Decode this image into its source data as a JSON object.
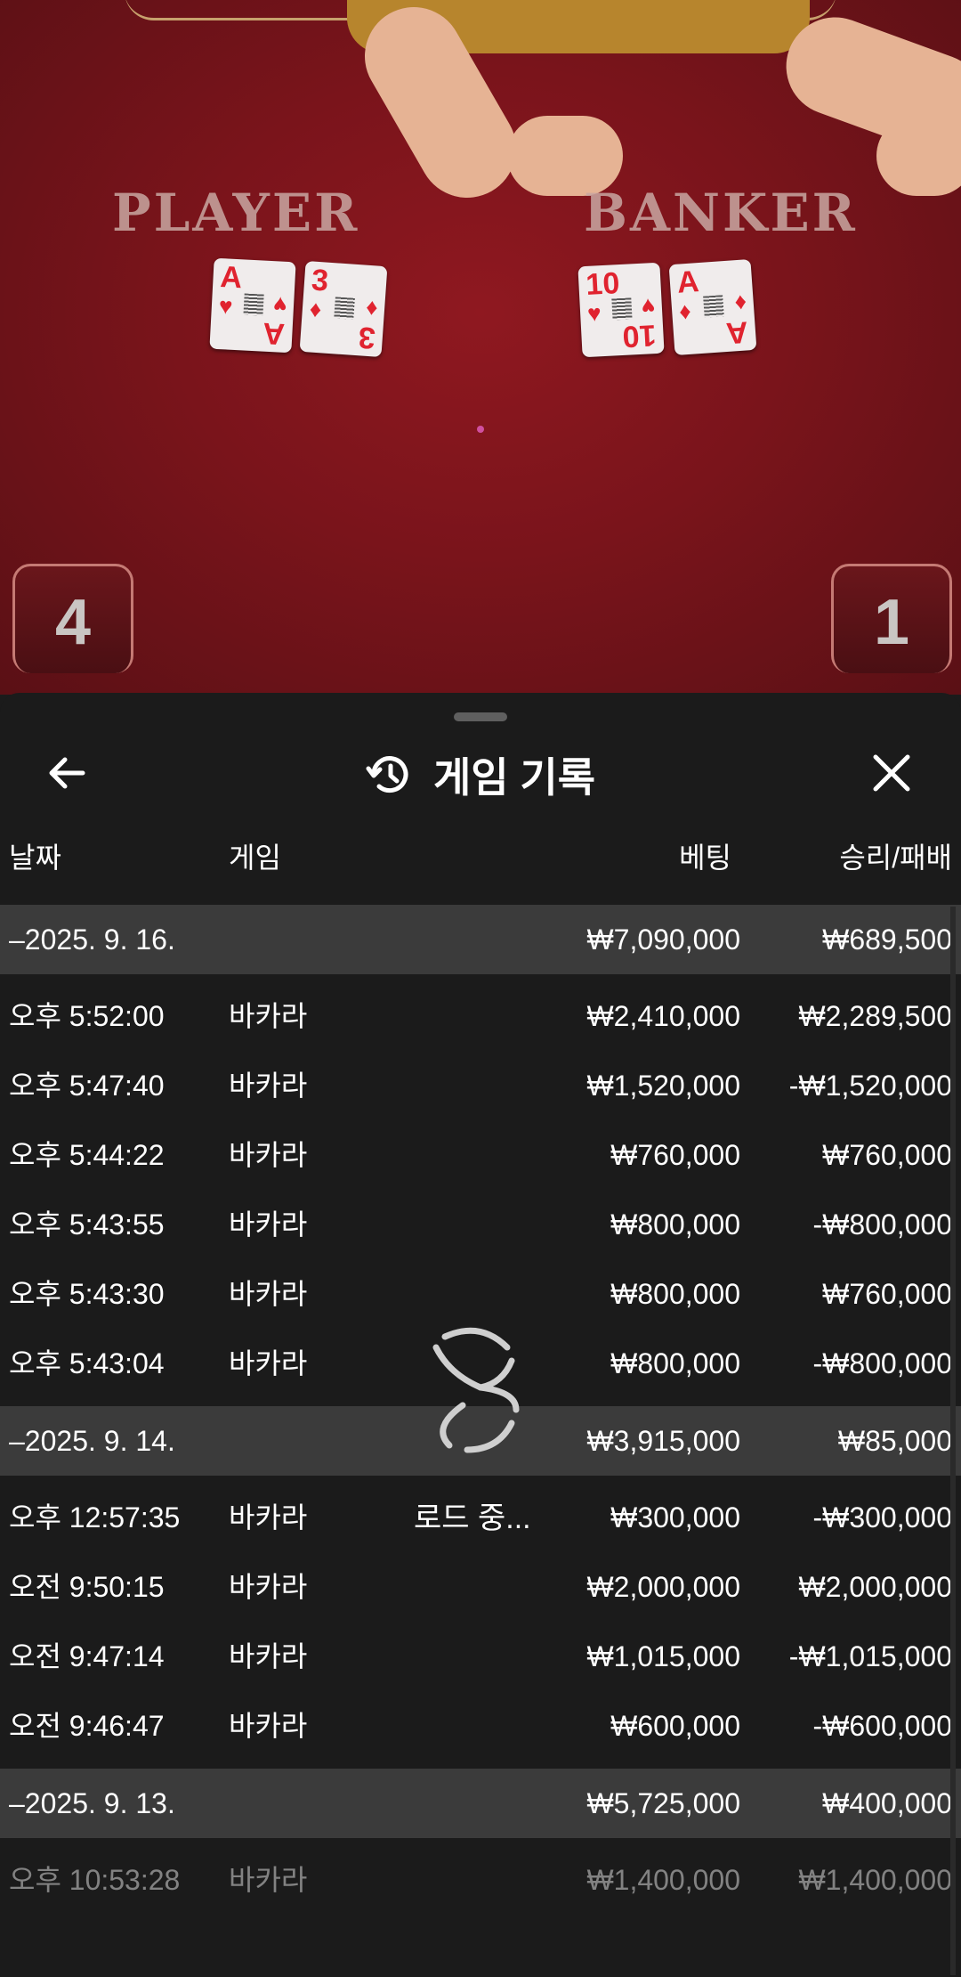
{
  "video": {
    "player_label": "PLAYER",
    "banker_label": "BANKER",
    "player_cards": [
      {
        "rank": "A",
        "suit": "♥"
      },
      {
        "rank": "3",
        "suit": "♦"
      }
    ],
    "banker_cards": [
      {
        "rank": "10",
        "suit": "♥"
      },
      {
        "rank": "A",
        "suit": "♦"
      }
    ],
    "player_score": "4",
    "banker_score": "1"
  },
  "header": {
    "title": "게임 기록",
    "back_icon": "arrow-left-icon",
    "history_icon": "history-icon",
    "close_icon": "close-icon"
  },
  "columns": {
    "date": "날짜",
    "game": "게임",
    "bet": "베팅",
    "result": "승리/패배"
  },
  "groups": [
    {
      "date": "–2025. 9. 16.",
      "bet_total": "₩7,090,000",
      "result_total": "₩689,500",
      "rows": [
        {
          "time": "오후 5:52:00",
          "game": "바카라",
          "bet": "₩2,410,000",
          "result": "₩2,289,500"
        },
        {
          "time": "오후 5:47:40",
          "game": "바카라",
          "bet": "₩1,520,000",
          "result": "-₩1,520,000"
        },
        {
          "time": "오후 5:44:22",
          "game": "바카라",
          "bet": "₩760,000",
          "result": "₩760,000"
        },
        {
          "time": "오후 5:43:55",
          "game": "바카라",
          "bet": "₩800,000",
          "result": "-₩800,000"
        },
        {
          "time": "오후 5:43:30",
          "game": "바카라",
          "bet": "₩800,000",
          "result": "₩760,000"
        },
        {
          "time": "오후 5:43:04",
          "game": "바카라",
          "bet": "₩800,000",
          "result": "-₩800,000"
        }
      ]
    },
    {
      "date": "–2025. 9. 14.",
      "bet_total": "₩3,915,000",
      "result_total": "₩85,000",
      "rows": [
        {
          "time": "오후 12:57:35",
          "game": "바카라",
          "bet": "₩300,000",
          "result": "-₩300,000"
        },
        {
          "time": "오전 9:50:15",
          "game": "바카라",
          "bet": "₩2,000,000",
          "result": "₩2,000,000"
        },
        {
          "time": "오전 9:47:14",
          "game": "바카라",
          "bet": "₩1,015,000",
          "result": "-₩1,015,000"
        },
        {
          "time": "오전 9:46:47",
          "game": "바카라",
          "bet": "₩600,000",
          "result": "-₩600,000"
        }
      ]
    },
    {
      "date": "–2025. 9. 13.",
      "bet_total": "₩5,725,000",
      "result_total": "₩400,000",
      "rows": [
        {
          "time": "오후 10:53:28",
          "game": "바카라",
          "bet": "₩1,400,000",
          "result": "₩1,400,000"
        }
      ]
    }
  ],
  "loading": {
    "text": "로드 중...",
    "icon": "spinner-icon"
  }
}
